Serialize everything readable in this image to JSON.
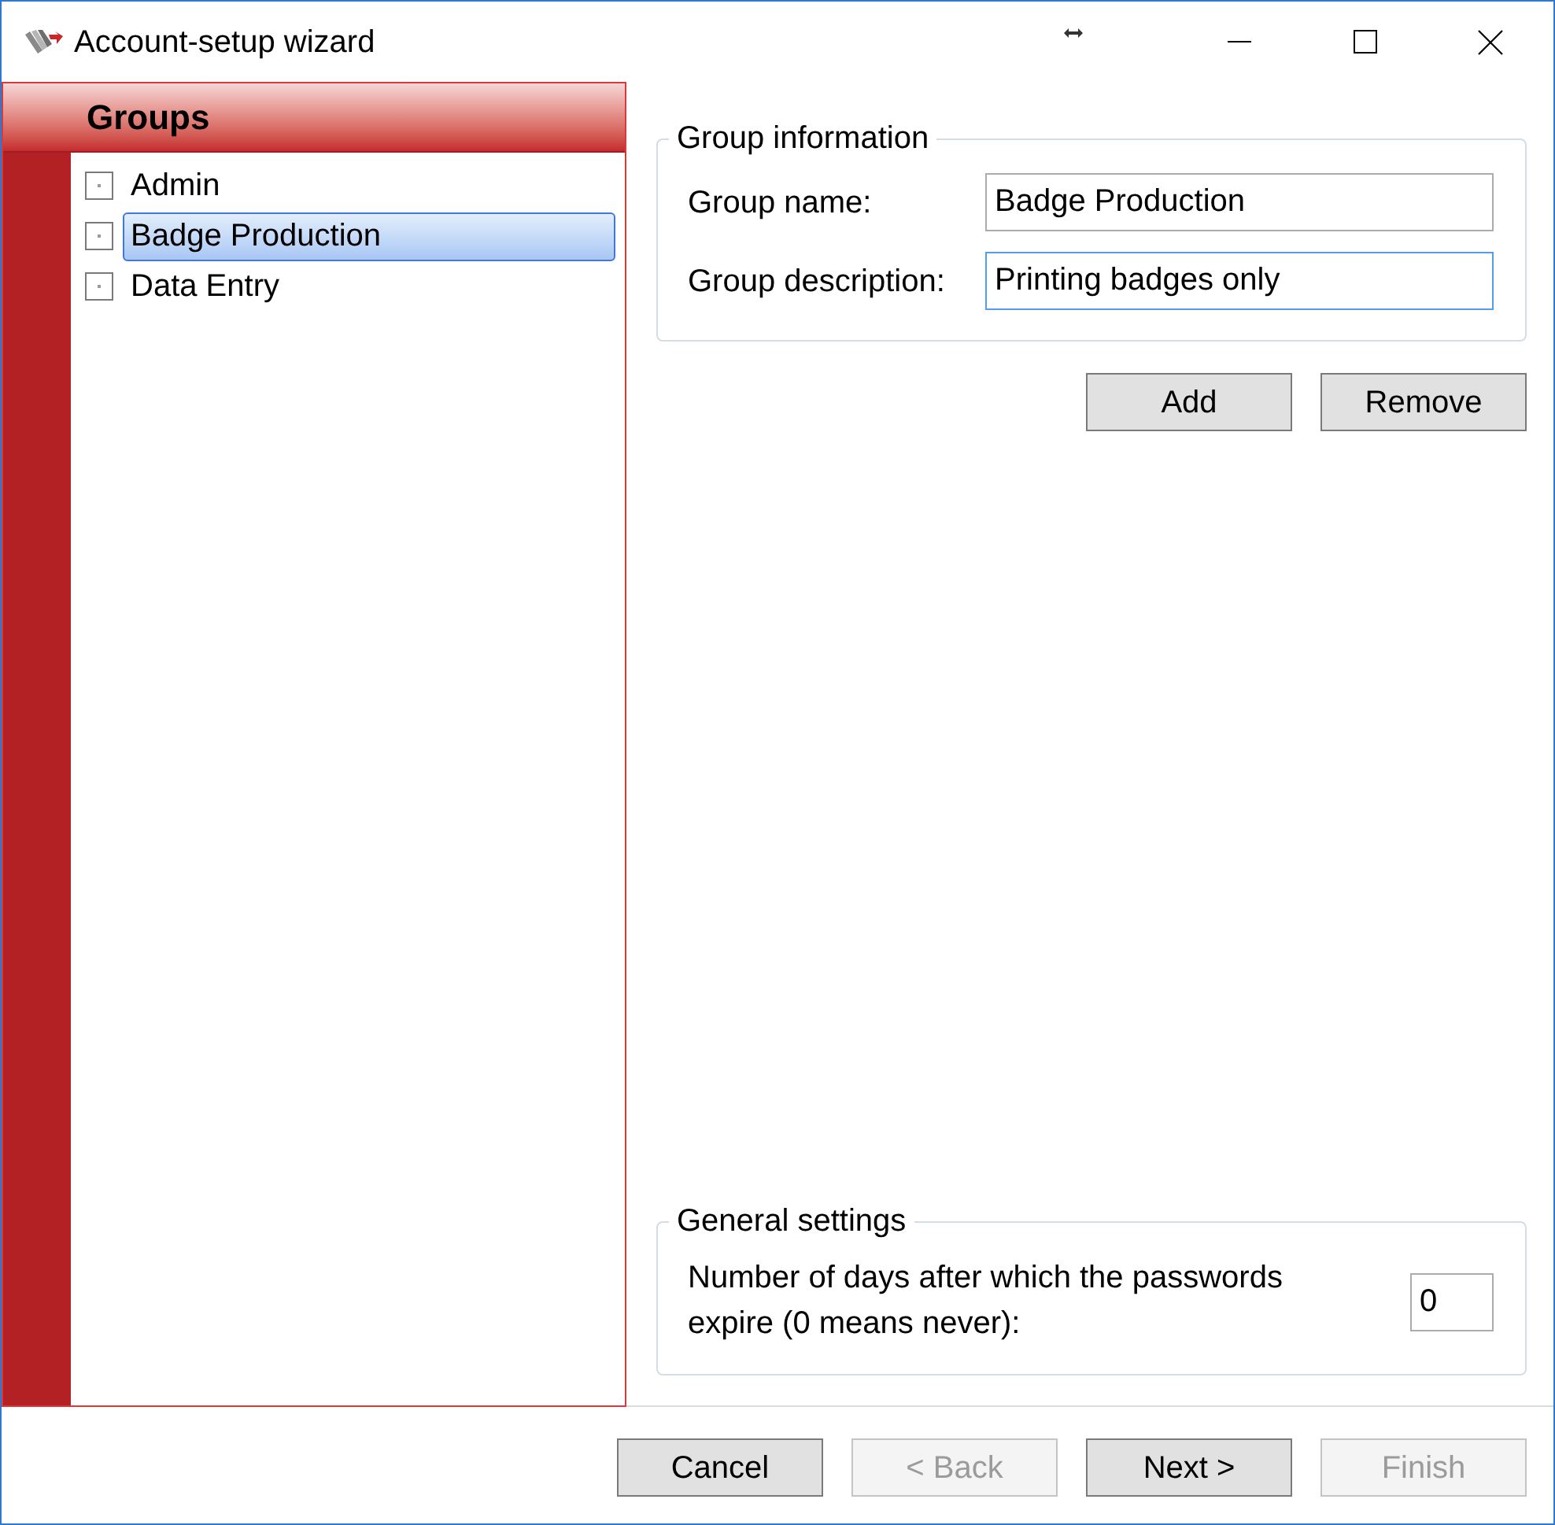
{
  "window": {
    "title": "Account-setup wizard"
  },
  "groups_panel": {
    "title": "Groups",
    "items": [
      {
        "label": "Admin",
        "checked": false,
        "selected": false
      },
      {
        "label": "Badge Production",
        "checked": false,
        "selected": true
      },
      {
        "label": "Data Entry",
        "checked": false,
        "selected": false
      }
    ]
  },
  "group_information": {
    "legend": "Group information",
    "fields": [
      {
        "label": "Group name:",
        "value": "Badge Production",
        "focused": false
      },
      {
        "label": "Group description:",
        "value": "Printing badges only",
        "focused": true
      }
    ],
    "buttons": [
      {
        "label": "Add",
        "disabled": false
      },
      {
        "label": "Remove",
        "disabled": false
      }
    ]
  },
  "general_settings": {
    "legend": "General settings",
    "fields": [
      {
        "label": "Number of days after which the passwords expire (0 means never):",
        "value": "0",
        "focused": false
      }
    ]
  },
  "footer_buttons": [
    {
      "label": "Cancel",
      "disabled": false
    },
    {
      "label": "< Back",
      "disabled": true
    },
    {
      "label": "Next >",
      "disabled": false
    },
    {
      "label": "Finish",
      "disabled": true
    }
  ]
}
